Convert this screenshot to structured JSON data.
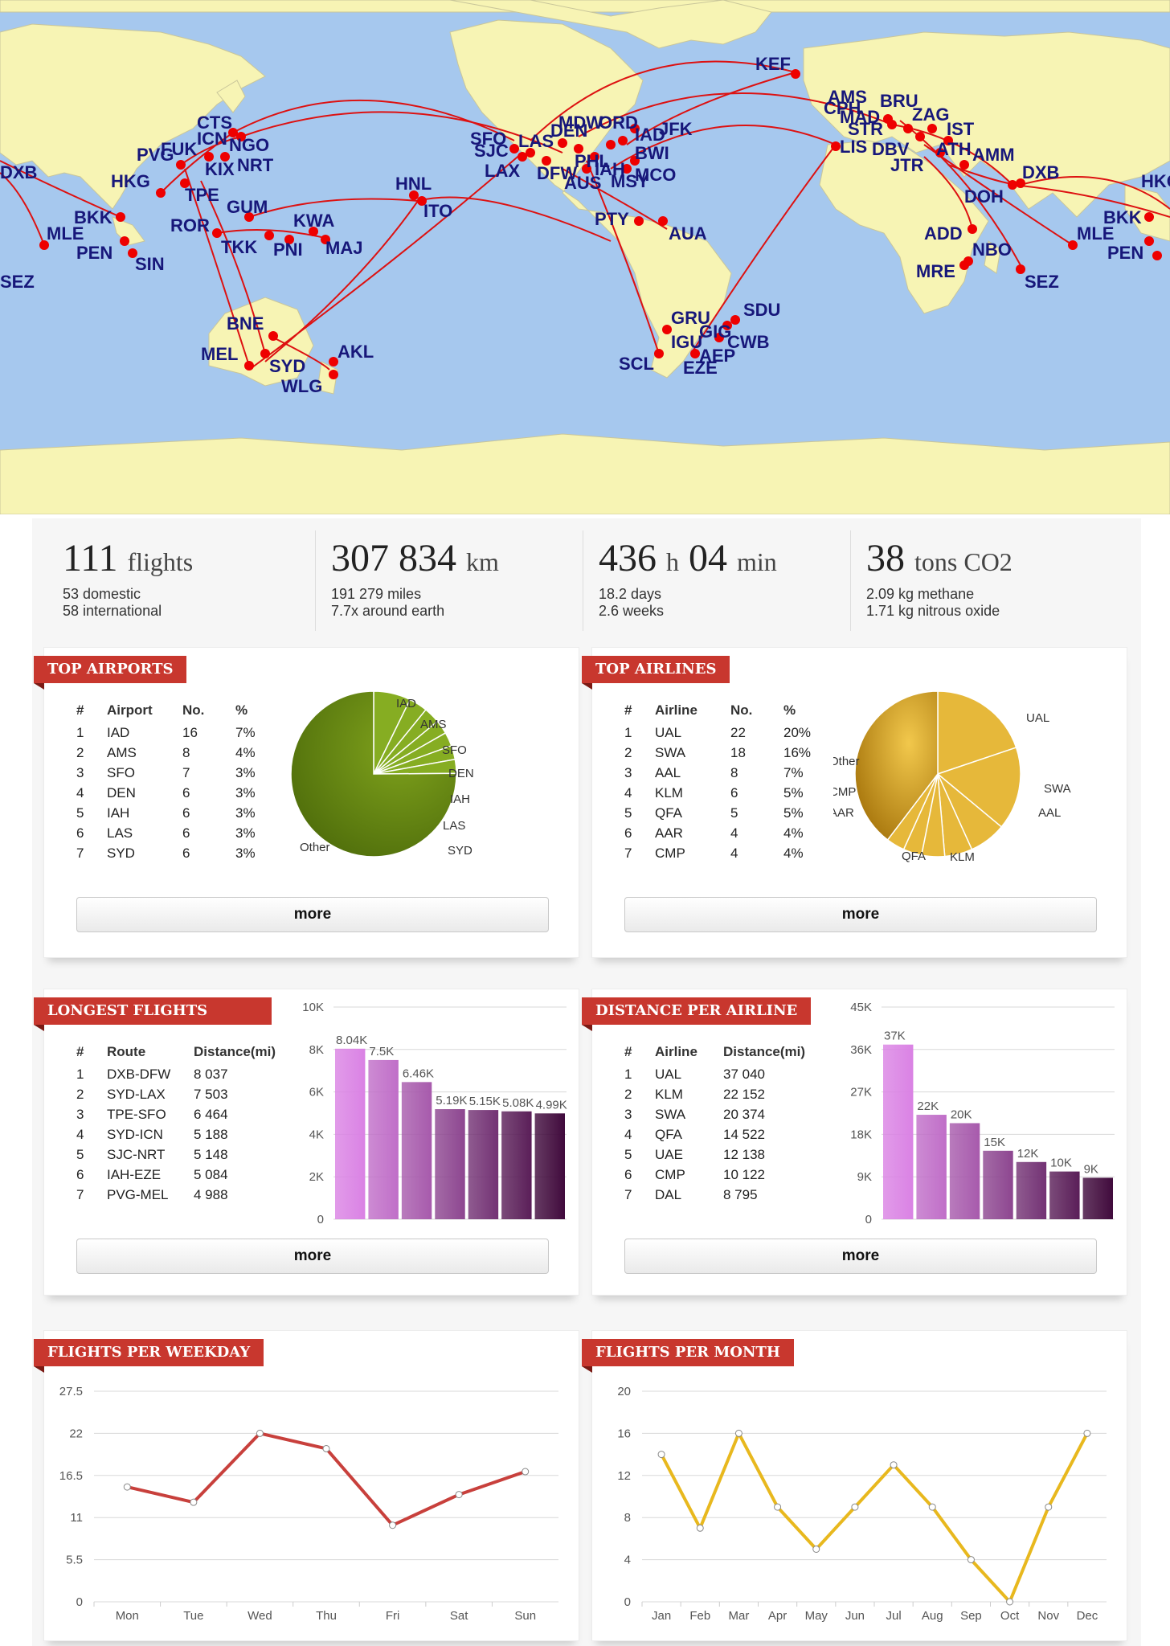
{
  "map": {
    "airports": [
      "DXB",
      "MLE",
      "SEZ",
      "PVG",
      "FUK",
      "CTS",
      "ICN",
      "NGO",
      "KIX",
      "NRT",
      "HKG",
      "TPE",
      "BKK",
      "PEN",
      "SIN",
      "ROR",
      "GUM",
      "KWA",
      "TKK",
      "PNI",
      "MAJ",
      "HNL",
      "ITO",
      "BNE",
      "MEL",
      "SYD",
      "AKL",
      "WLG",
      "SFO",
      "SJC",
      "LAS",
      "LAX",
      "DFW",
      "AUS",
      "MSY",
      "IAH",
      "MCO",
      "JFK",
      "BWI",
      "PHL",
      "DEN",
      "MDW",
      "ORD",
      "IAD",
      "PTY",
      "AUA",
      "GRU",
      "GIG",
      "SDU",
      "CWB",
      "IGU",
      "AEP",
      "EZE",
      "SCL",
      "KEF",
      "AMS",
      "BRU",
      "CPH",
      "MAD",
      "STR",
      "ZAG",
      "IST",
      "LIS",
      "DBV",
      "ATH",
      "AMM",
      "JTR",
      "DOH",
      "DXB",
      "ADD",
      "NBO",
      "MRE",
      "SEZ",
      "MLE",
      "PEN",
      "BKK",
      "HKG"
    ]
  },
  "stats": [
    {
      "value": "111",
      "unit": "flights",
      "lines": [
        "53 domestic",
        "58 international"
      ]
    },
    {
      "value": "307 834",
      "unit": "km",
      "lines": [
        "191 279 miles",
        "7.7x around earth"
      ]
    },
    {
      "value": "436",
      "unit": "h",
      "value2": "04",
      "unit2": "min",
      "lines": [
        "18.2 days",
        "2.6 weeks"
      ]
    },
    {
      "value": "38",
      "unit": "tons CO2",
      "lines": [
        "2.09 kg methane",
        "1.71 kg nitrous oxide"
      ]
    }
  ],
  "top_airports": {
    "title": "TOP AIRPORTS",
    "columns": [
      "#",
      "Airport",
      "No.",
      "%"
    ],
    "rows": [
      [
        "1",
        "IAD",
        "16",
        "7%"
      ],
      [
        "2",
        "AMS",
        "8",
        "4%"
      ],
      [
        "3",
        "SFO",
        "7",
        "3%"
      ],
      [
        "4",
        "DEN",
        "6",
        "3%"
      ],
      [
        "5",
        "IAH",
        "6",
        "3%"
      ],
      [
        "6",
        "LAS",
        "6",
        "3%"
      ],
      [
        "7",
        "SYD",
        "6",
        "3%"
      ]
    ],
    "more": "more"
  },
  "top_airlines": {
    "title": "TOP AIRLINES",
    "columns": [
      "#",
      "Airline",
      "No.",
      "%"
    ],
    "rows": [
      [
        "1",
        "UAL",
        "22",
        "20%"
      ],
      [
        "2",
        "SWA",
        "18",
        "16%"
      ],
      [
        "3",
        "AAL",
        "8",
        "7%"
      ],
      [
        "4",
        "KLM",
        "6",
        "5%"
      ],
      [
        "5",
        "QFA",
        "5",
        "5%"
      ],
      [
        "6",
        "AAR",
        "4",
        "4%"
      ],
      [
        "7",
        "CMP",
        "4",
        "4%"
      ]
    ],
    "more": "more"
  },
  "longest_flights": {
    "title": "LONGEST FLIGHTS",
    "columns": [
      "#",
      "Route",
      "Distance(mi)"
    ],
    "rows": [
      [
        "1",
        "DXB-DFW",
        "8 037"
      ],
      [
        "2",
        "SYD-LAX",
        "7 503"
      ],
      [
        "3",
        "TPE-SFO",
        "6 464"
      ],
      [
        "4",
        "SYD-ICN",
        "5 188"
      ],
      [
        "5",
        "SJC-NRT",
        "5 148"
      ],
      [
        "6",
        "IAH-EZE",
        "5 084"
      ],
      [
        "7",
        "PVG-MEL",
        "4 988"
      ]
    ],
    "more": "more"
  },
  "distance_per_airline": {
    "title": "DISTANCE PER AIRLINE",
    "columns": [
      "#",
      "Airline",
      "Distance(mi)"
    ],
    "rows": [
      [
        "1",
        "UAL",
        "37 040"
      ],
      [
        "2",
        "KLM",
        "22 152"
      ],
      [
        "3",
        "SWA",
        "20 374"
      ],
      [
        "4",
        "QFA",
        "14 522"
      ],
      [
        "5",
        "UAE",
        "12 138"
      ],
      [
        "6",
        "CMP",
        "10 122"
      ],
      [
        "7",
        "DAL",
        "8 795"
      ]
    ],
    "more": "more"
  },
  "flights_weekday": {
    "title": "FLIGHTS PER WEEKDAY"
  },
  "flights_month": {
    "title": "FLIGHTS PER MONTH"
  },
  "chart_data": [
    {
      "type": "pie",
      "id": "airports_pie",
      "categories": [
        "IAD",
        "AMS",
        "SFO",
        "DEN",
        "IAH",
        "LAS",
        "SYD",
        "Other"
      ],
      "values": [
        16,
        8,
        7,
        6,
        6,
        6,
        6,
        166
      ],
      "colors": {
        "main": "#5a7c10",
        "slices": "#86ad22"
      }
    },
    {
      "type": "pie",
      "id": "airlines_pie",
      "categories": [
        "UAL",
        "SWA",
        "AAL",
        "KLM",
        "QFA",
        "AAR",
        "CMP",
        "Other"
      ],
      "values": [
        22,
        18,
        8,
        6,
        5,
        4,
        4,
        44
      ],
      "colors": {
        "main": "#b8870a",
        "slices": "#e6b83a"
      }
    },
    {
      "type": "bar",
      "id": "longest_bar",
      "categories": [
        "DXB-DFW",
        "SYD-LAX",
        "TPE-SFO",
        "SYD-ICN",
        "SJC-NRT",
        "IAH-EZE",
        "PVG-MEL"
      ],
      "values": [
        8037,
        7503,
        6464,
        5188,
        5148,
        5084,
        4988
      ],
      "data_labels": [
        "8.04K",
        "7.5K",
        "6.46K",
        "5.19K",
        "5.15K",
        "5.08K",
        "4.99K"
      ],
      "yticks": [
        "0",
        "2K",
        "4K",
        "6K",
        "8K",
        "10K"
      ],
      "ylim": [
        0,
        10000
      ]
    },
    {
      "type": "bar",
      "id": "airline_bar",
      "categories": [
        "UAL",
        "KLM",
        "SWA",
        "QFA",
        "UAE",
        "CMP",
        "DAL"
      ],
      "values": [
        37040,
        22152,
        20374,
        14522,
        12138,
        10122,
        8795
      ],
      "data_labels": [
        "37K",
        "22K",
        "20K",
        "15K",
        "12K",
        "10K",
        "9K"
      ],
      "yticks": [
        "0",
        "9K",
        "18K",
        "27K",
        "36K",
        "45K"
      ],
      "ylim": [
        0,
        45000
      ]
    },
    {
      "type": "line",
      "id": "weekday_line",
      "categories": [
        "Mon",
        "Tue",
        "Wed",
        "Thu",
        "Fri",
        "Sat",
        "Sun"
      ],
      "values": [
        15,
        13,
        22,
        20,
        10,
        14,
        17
      ],
      "yticks": [
        "0",
        "5.5",
        "11",
        "16.5",
        "22",
        "27.5"
      ],
      "ylim": [
        0,
        27.5
      ],
      "color": "#c8403c"
    },
    {
      "type": "line",
      "id": "month_line",
      "categories": [
        "Jan",
        "Feb",
        "Mar",
        "Apr",
        "May",
        "Jun",
        "Jul",
        "Aug",
        "Sep",
        "Oct",
        "Nov",
        "Dec"
      ],
      "values": [
        14,
        7,
        16,
        9,
        5,
        9,
        13,
        9,
        4,
        0,
        9,
        16
      ],
      "yticks": [
        "0",
        "4",
        "8",
        "12",
        "16",
        "20"
      ],
      "ylim": [
        0,
        20
      ],
      "color": "#e8b81e"
    }
  ]
}
